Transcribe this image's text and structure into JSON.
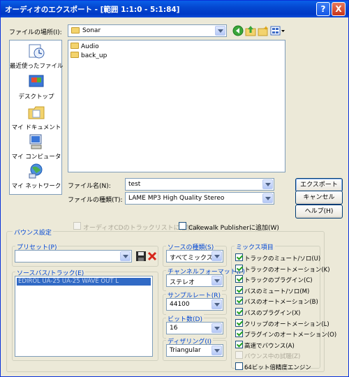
{
  "window": {
    "title": "オーディオのエクスポート - [範囲 1:1:0 - 5:1:84]",
    "help_glyph": "?",
    "close_glyph": "X"
  },
  "location": {
    "label": "ファイルの場所(I):",
    "value": "Sonar"
  },
  "places": [
    {
      "label": "最近使ったファイル"
    },
    {
      "label": "デスクトップ"
    },
    {
      "label": "マイ ドキュメント"
    },
    {
      "label": "マイ コンピュータ"
    },
    {
      "label": "マイ ネットワーク"
    }
  ],
  "files": [
    {
      "name": "Audio"
    },
    {
      "name": "back_up"
    }
  ],
  "filename": {
    "label": "ファイル名(N):",
    "value": "test"
  },
  "filetype": {
    "label": "ファイルの種類(T):",
    "value": "LAME MP3 High Quality Stereo"
  },
  "buttons": {
    "export": "エクスポート",
    "cancel": "キャンセル",
    "help": "ヘルプ(H)"
  },
  "options": {
    "audio_cd": "オーディオCDのトラックリストに追加(T)",
    "cakewalk": "Cakewalk Publisherに追加(W)"
  },
  "bounce": {
    "group_title": "バウンス設定",
    "preset_title": "プリセット(P)",
    "preset_value": "",
    "source_title": "ソースバス/トラック(E)",
    "source_items": [
      "EDIROL UA-25 UA-25 WAVE OUT L"
    ],
    "source_type_title": "ソースの種類(S)",
    "source_type_value": "すべてミックス",
    "channel_title": "チャンネルフォーマット(F)",
    "channel_value": "ステレオ",
    "samplerate_title": "サンプルレート(R)",
    "samplerate_value": "44100",
    "bitdepth_title": "ビット数(D)",
    "bitdepth_value": "16",
    "dither_title": "ディザリング(I)",
    "dither_value": "Triangular",
    "mix_title": "ミックス項目",
    "mix_items": [
      {
        "label": "トラックのミュート/ソロ(U)",
        "checked": true,
        "enabled": true
      },
      {
        "label": "トラックのオートメーション(K)",
        "checked": true,
        "enabled": true
      },
      {
        "label": "トラックのプラグイン(C)",
        "checked": true,
        "enabled": true
      },
      {
        "label": "バスのミュート/ソロ(M)",
        "checked": true,
        "enabled": true
      },
      {
        "label": "バスのオートメーション(B)",
        "checked": true,
        "enabled": true
      },
      {
        "label": "バスのプラグイン(X)",
        "checked": true,
        "enabled": true
      },
      {
        "label": "クリップのオートメーション(L)",
        "checked": true,
        "enabled": true
      },
      {
        "label": "プラグインのオートメーション(O)",
        "checked": true,
        "enabled": true
      },
      {
        "label": "高速でバウンス(A)",
        "checked": true,
        "enabled": true
      },
      {
        "label": "バウンス中の試聴(Z)",
        "checked": false,
        "enabled": false
      },
      {
        "label": "64ビット倍精度エンジン",
        "checked": false,
        "enabled": true
      }
    ]
  }
}
